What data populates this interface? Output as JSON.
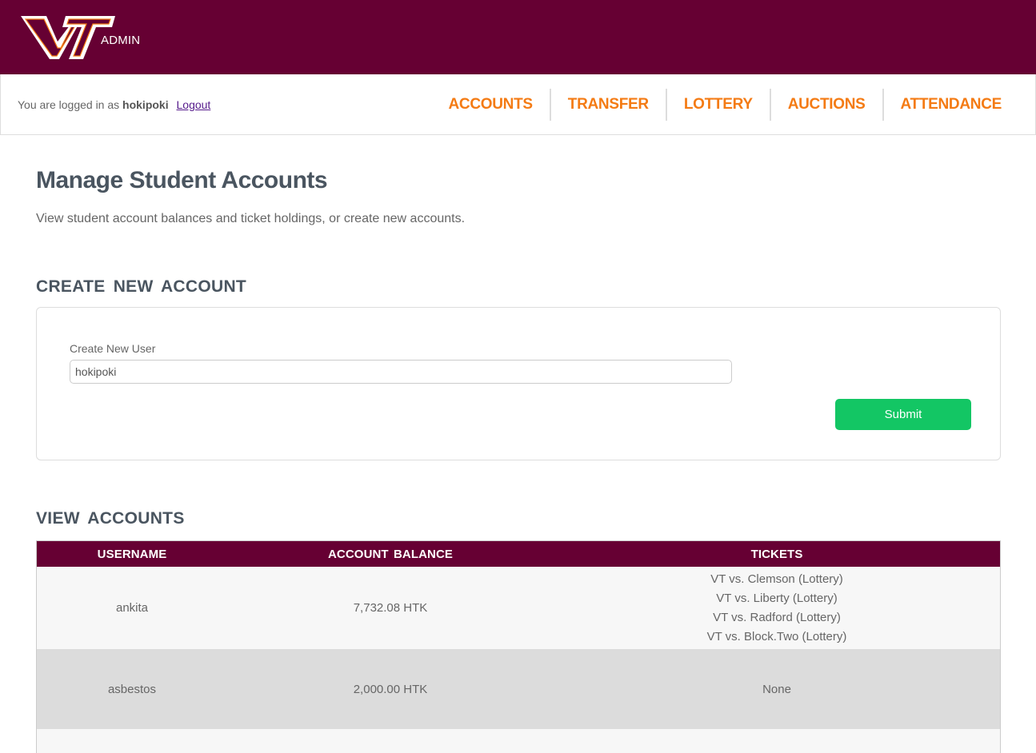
{
  "header": {
    "logo_text": "VT",
    "admin_label": "ADMIN"
  },
  "navbar": {
    "login_prefix": "You are logged in as",
    "username": "hokipoki",
    "logout_label": "Logout",
    "links": [
      "ACCOUNTS",
      "TRANSFER",
      "LOTTERY",
      "AUCTIONS",
      "ATTENDANCE"
    ]
  },
  "page": {
    "title": "Manage Student Accounts",
    "subtitle": "View student account balances and ticket holdings, or create new accounts."
  },
  "create_section": {
    "title": "CREATE NEW ACCOUNT",
    "field_label": "Create New User",
    "field_value": "hokipoki",
    "submit_label": "Submit"
  },
  "view_section": {
    "title": "VIEW ACCOUNTS",
    "columns": [
      "USERNAME",
      "ACCOUNT BALANCE",
      "TICKETS"
    ],
    "rows": [
      {
        "username": "ankita",
        "balance": "7,732.08 HTK",
        "tickets": [
          "VT vs. Clemson (Lottery)",
          "VT vs. Liberty (Lottery)",
          "VT vs. Radford (Lottery)",
          "VT vs. Block.Two (Lottery)"
        ]
      },
      {
        "username": "asbestos",
        "balance": "2,000.00 HTK",
        "tickets": [
          "None"
        ]
      }
    ]
  },
  "colors": {
    "brand_maroon": "#660033",
    "brand_orange": "#f47b14",
    "submit_green": "#13c664"
  }
}
